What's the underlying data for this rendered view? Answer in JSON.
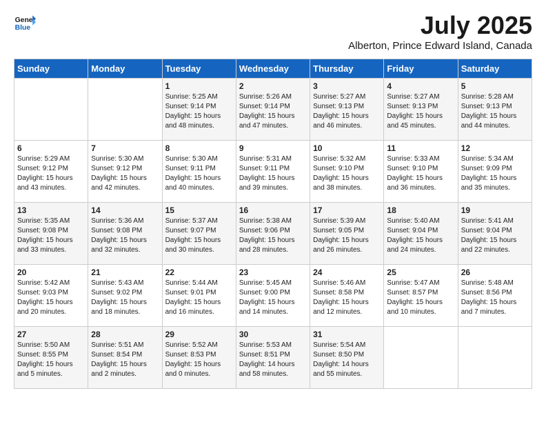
{
  "logo": {
    "line1": "General",
    "line2": "Blue"
  },
  "title": "July 2025",
  "subtitle": "Alberton, Prince Edward Island, Canada",
  "weekdays": [
    "Sunday",
    "Monday",
    "Tuesday",
    "Wednesday",
    "Thursday",
    "Friday",
    "Saturday"
  ],
  "weeks": [
    [
      {
        "day": "",
        "sunrise": "",
        "sunset": "",
        "daylight": ""
      },
      {
        "day": "",
        "sunrise": "",
        "sunset": "",
        "daylight": ""
      },
      {
        "day": "1",
        "sunrise": "Sunrise: 5:25 AM",
        "sunset": "Sunset: 9:14 PM",
        "daylight": "Daylight: 15 hours and 48 minutes."
      },
      {
        "day": "2",
        "sunrise": "Sunrise: 5:26 AM",
        "sunset": "Sunset: 9:14 PM",
        "daylight": "Daylight: 15 hours and 47 minutes."
      },
      {
        "day": "3",
        "sunrise": "Sunrise: 5:27 AM",
        "sunset": "Sunset: 9:13 PM",
        "daylight": "Daylight: 15 hours and 46 minutes."
      },
      {
        "day": "4",
        "sunrise": "Sunrise: 5:27 AM",
        "sunset": "Sunset: 9:13 PM",
        "daylight": "Daylight: 15 hours and 45 minutes."
      },
      {
        "day": "5",
        "sunrise": "Sunrise: 5:28 AM",
        "sunset": "Sunset: 9:13 PM",
        "daylight": "Daylight: 15 hours and 44 minutes."
      }
    ],
    [
      {
        "day": "6",
        "sunrise": "Sunrise: 5:29 AM",
        "sunset": "Sunset: 9:12 PM",
        "daylight": "Daylight: 15 hours and 43 minutes."
      },
      {
        "day": "7",
        "sunrise": "Sunrise: 5:30 AM",
        "sunset": "Sunset: 9:12 PM",
        "daylight": "Daylight: 15 hours and 42 minutes."
      },
      {
        "day": "8",
        "sunrise": "Sunrise: 5:30 AM",
        "sunset": "Sunset: 9:11 PM",
        "daylight": "Daylight: 15 hours and 40 minutes."
      },
      {
        "day": "9",
        "sunrise": "Sunrise: 5:31 AM",
        "sunset": "Sunset: 9:11 PM",
        "daylight": "Daylight: 15 hours and 39 minutes."
      },
      {
        "day": "10",
        "sunrise": "Sunrise: 5:32 AM",
        "sunset": "Sunset: 9:10 PM",
        "daylight": "Daylight: 15 hours and 38 minutes."
      },
      {
        "day": "11",
        "sunrise": "Sunrise: 5:33 AM",
        "sunset": "Sunset: 9:10 PM",
        "daylight": "Daylight: 15 hours and 36 minutes."
      },
      {
        "day": "12",
        "sunrise": "Sunrise: 5:34 AM",
        "sunset": "Sunset: 9:09 PM",
        "daylight": "Daylight: 15 hours and 35 minutes."
      }
    ],
    [
      {
        "day": "13",
        "sunrise": "Sunrise: 5:35 AM",
        "sunset": "Sunset: 9:08 PM",
        "daylight": "Daylight: 15 hours and 33 minutes."
      },
      {
        "day": "14",
        "sunrise": "Sunrise: 5:36 AM",
        "sunset": "Sunset: 9:08 PM",
        "daylight": "Daylight: 15 hours and 32 minutes."
      },
      {
        "day": "15",
        "sunrise": "Sunrise: 5:37 AM",
        "sunset": "Sunset: 9:07 PM",
        "daylight": "Daylight: 15 hours and 30 minutes."
      },
      {
        "day": "16",
        "sunrise": "Sunrise: 5:38 AM",
        "sunset": "Sunset: 9:06 PM",
        "daylight": "Daylight: 15 hours and 28 minutes."
      },
      {
        "day": "17",
        "sunrise": "Sunrise: 5:39 AM",
        "sunset": "Sunset: 9:05 PM",
        "daylight": "Daylight: 15 hours and 26 minutes."
      },
      {
        "day": "18",
        "sunrise": "Sunrise: 5:40 AM",
        "sunset": "Sunset: 9:04 PM",
        "daylight": "Daylight: 15 hours and 24 minutes."
      },
      {
        "day": "19",
        "sunrise": "Sunrise: 5:41 AM",
        "sunset": "Sunset: 9:04 PM",
        "daylight": "Daylight: 15 hours and 22 minutes."
      }
    ],
    [
      {
        "day": "20",
        "sunrise": "Sunrise: 5:42 AM",
        "sunset": "Sunset: 9:03 PM",
        "daylight": "Daylight: 15 hours and 20 minutes."
      },
      {
        "day": "21",
        "sunrise": "Sunrise: 5:43 AM",
        "sunset": "Sunset: 9:02 PM",
        "daylight": "Daylight: 15 hours and 18 minutes."
      },
      {
        "day": "22",
        "sunrise": "Sunrise: 5:44 AM",
        "sunset": "Sunset: 9:01 PM",
        "daylight": "Daylight: 15 hours and 16 minutes."
      },
      {
        "day": "23",
        "sunrise": "Sunrise: 5:45 AM",
        "sunset": "Sunset: 9:00 PM",
        "daylight": "Daylight: 15 hours and 14 minutes."
      },
      {
        "day": "24",
        "sunrise": "Sunrise: 5:46 AM",
        "sunset": "Sunset: 8:58 PM",
        "daylight": "Daylight: 15 hours and 12 minutes."
      },
      {
        "day": "25",
        "sunrise": "Sunrise: 5:47 AM",
        "sunset": "Sunset: 8:57 PM",
        "daylight": "Daylight: 15 hours and 10 minutes."
      },
      {
        "day": "26",
        "sunrise": "Sunrise: 5:48 AM",
        "sunset": "Sunset: 8:56 PM",
        "daylight": "Daylight: 15 hours and 7 minutes."
      }
    ],
    [
      {
        "day": "27",
        "sunrise": "Sunrise: 5:50 AM",
        "sunset": "Sunset: 8:55 PM",
        "daylight": "Daylight: 15 hours and 5 minutes."
      },
      {
        "day": "28",
        "sunrise": "Sunrise: 5:51 AM",
        "sunset": "Sunset: 8:54 PM",
        "daylight": "Daylight: 15 hours and 2 minutes."
      },
      {
        "day": "29",
        "sunrise": "Sunrise: 5:52 AM",
        "sunset": "Sunset: 8:53 PM",
        "daylight": "Daylight: 15 hours and 0 minutes."
      },
      {
        "day": "30",
        "sunrise": "Sunrise: 5:53 AM",
        "sunset": "Sunset: 8:51 PM",
        "daylight": "Daylight: 14 hours and 58 minutes."
      },
      {
        "day": "31",
        "sunrise": "Sunrise: 5:54 AM",
        "sunset": "Sunset: 8:50 PM",
        "daylight": "Daylight: 14 hours and 55 minutes."
      },
      {
        "day": "",
        "sunrise": "",
        "sunset": "",
        "daylight": ""
      },
      {
        "day": "",
        "sunrise": "",
        "sunset": "",
        "daylight": ""
      }
    ]
  ]
}
